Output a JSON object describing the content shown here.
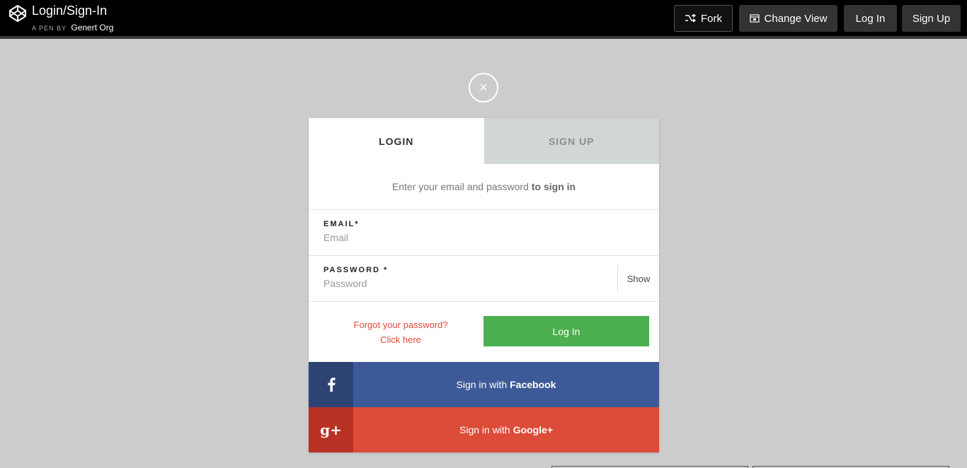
{
  "topbar": {
    "pen_title": "Login/Sign-In",
    "pen_by": "A PEN BY",
    "author": "Genert Org",
    "buttons": {
      "fork": "Fork",
      "change_view": "Change View",
      "login": "Log In",
      "signup": "Sign Up"
    }
  },
  "modal": {
    "close_glyph": "×",
    "tabs": {
      "login": "LOGIN",
      "signup": "SIGN UP"
    },
    "subtitle": {
      "prefix": "Enter your email and password",
      "emphasis": "to sign in"
    },
    "email": {
      "label": "EMAIL*",
      "value": "",
      "placeholder": "Email"
    },
    "password": {
      "label": "PASSWORD *",
      "value": "",
      "placeholder": "Password",
      "show_label": "Show"
    },
    "forgot": {
      "line1": "Forgot your password?",
      "line2": "Click here"
    },
    "login_button": "Log In",
    "facebook": {
      "prefix": "Sign in with",
      "brand": "Facebook"
    },
    "google": {
      "prefix": "Sign in with",
      "brand": "Google+",
      "icon_glyph": "g+"
    }
  },
  "colors": {
    "background": "#cccccc",
    "login_green": "#4caf50",
    "facebook_blue": "#3d5a98",
    "google_red": "#dd4b39",
    "link_red": "#e04b3b"
  }
}
